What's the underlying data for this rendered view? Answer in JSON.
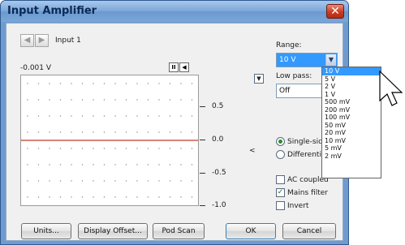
{
  "window": {
    "title": "Input Amplifier",
    "close_glyph": "✕"
  },
  "nav": {
    "back_glyph": "◀",
    "forward_glyph": "▶",
    "channel_label": "Input 1"
  },
  "scope": {
    "readout": "-0.001 V",
    "y_ticks": [
      "0.5",
      "0.0",
      "-0.5",
      "-1.0"
    ],
    "pause_glyph": "II",
    "arrow_glyph": "◀",
    "trace_color": "#c0392b",
    "side_symbol": "<"
  },
  "range": {
    "label": "Range:",
    "value": "10 V",
    "options": [
      "10 V",
      "5 V",
      "2 V",
      "1 V",
      "500 mV",
      "200 mV",
      "100 mV",
      "50 mV",
      "20 mV",
      "10 mV",
      "5 mV",
      "2 mV"
    ],
    "selected_index": 0
  },
  "lowpass": {
    "label": "Low pass:",
    "value": "Off"
  },
  "input_mode": {
    "single": "Single-sided",
    "differential": "Differential",
    "selected": "single"
  },
  "options": {
    "ac_coupled": "AC coupled",
    "mains_filter": "Mains filter",
    "invert": "Invert",
    "ac_checked": false,
    "mains_checked": true,
    "invert_checked": false
  },
  "buttons": {
    "units": "Units...",
    "display_offset": "Display Offset...",
    "pod_scan": "Pod Scan",
    "ok": "OK",
    "cancel": "Cancel"
  },
  "colors": {
    "title_bar": "#7aa6d9",
    "selection": "#3399ff",
    "checkbox_mark": "#1d6a1d"
  }
}
